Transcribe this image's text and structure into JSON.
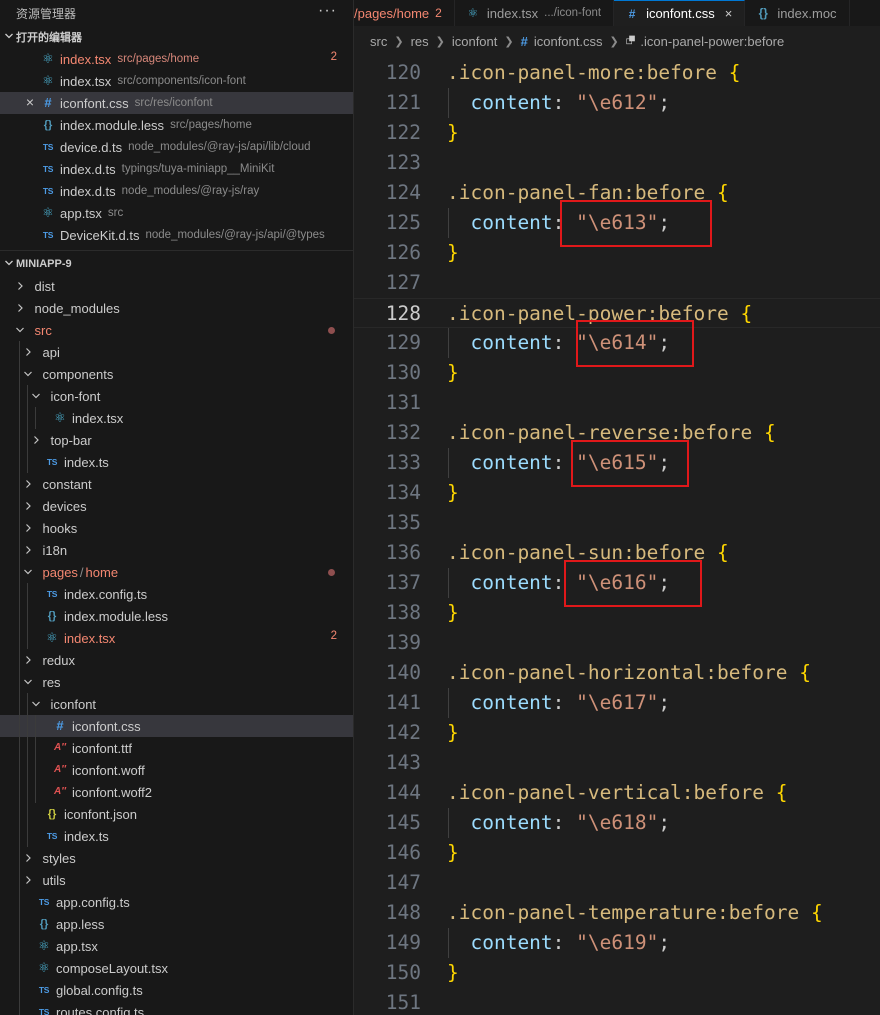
{
  "sidebar": {
    "title": "资源管理器",
    "more_label": "···",
    "open_editors": {
      "header": "打开的编辑器",
      "items": [
        {
          "icon": "react",
          "name": "index.tsx",
          "desc": "src/pages/home",
          "badge": "2",
          "modified": true,
          "active": false
        },
        {
          "icon": "react",
          "name": "index.tsx",
          "desc": "src/components/icon-font",
          "badge": "",
          "modified": false,
          "active": false
        },
        {
          "icon": "hash",
          "name": "iconfont.css",
          "desc": "src/res/iconfont",
          "badge": "",
          "modified": false,
          "active": true
        },
        {
          "icon": "braces",
          "name": "index.module.less",
          "desc": "src/pages/home",
          "badge": "",
          "modified": false,
          "active": false
        },
        {
          "icon": "ts",
          "name": "device.d.ts",
          "desc": "node_modules/@ray-js/api/lib/cloud",
          "badge": "",
          "modified": false,
          "active": false
        },
        {
          "icon": "ts",
          "name": "index.d.ts",
          "desc": "typings/tuya-miniapp__MiniKit",
          "badge": "",
          "modified": false,
          "active": false
        },
        {
          "icon": "ts",
          "name": "index.d.ts",
          "desc": "node_modules/@ray-js/ray",
          "badge": "",
          "modified": false,
          "active": false
        },
        {
          "icon": "react",
          "name": "app.tsx",
          "desc": "src",
          "badge": "",
          "modified": false,
          "active": false
        },
        {
          "icon": "ts",
          "name": "DeviceKit.d.ts",
          "desc": "node_modules/@ray-js/api/@types",
          "badge": "",
          "modified": false,
          "active": false
        }
      ],
      "close_label": "×"
    },
    "project": {
      "header": "MINIAPP-9",
      "tree": [
        {
          "depth": 0,
          "type": "folder",
          "open": false,
          "name": "dist"
        },
        {
          "depth": 0,
          "type": "folder",
          "open": false,
          "name": "node_modules"
        },
        {
          "depth": 0,
          "type": "folder",
          "open": true,
          "name": "src",
          "red": true,
          "dot": true
        },
        {
          "depth": 1,
          "type": "folder",
          "open": false,
          "name": "api"
        },
        {
          "depth": 1,
          "type": "folder",
          "open": true,
          "name": "components"
        },
        {
          "depth": 2,
          "type": "folder",
          "open": true,
          "name": "icon-font"
        },
        {
          "depth": 3,
          "type": "file",
          "icon": "react",
          "name": "index.tsx"
        },
        {
          "depth": 2,
          "type": "folder",
          "open": false,
          "name": "top-bar"
        },
        {
          "depth": 2,
          "type": "file",
          "icon": "ts",
          "name": "index.ts"
        },
        {
          "depth": 1,
          "type": "folder",
          "open": false,
          "name": "constant"
        },
        {
          "depth": 1,
          "type": "folder",
          "open": false,
          "name": "devices"
        },
        {
          "depth": 1,
          "type": "folder",
          "open": false,
          "name": "hooks"
        },
        {
          "depth": 1,
          "type": "folder",
          "open": false,
          "name": "i18n"
        },
        {
          "depth": 1,
          "type": "folder",
          "open": true,
          "name": "pages",
          "name2": "home",
          "red": true,
          "dot": true
        },
        {
          "depth": 2,
          "type": "file",
          "icon": "ts",
          "name": "index.config.ts"
        },
        {
          "depth": 2,
          "type": "file",
          "icon": "braces",
          "name": "index.module.less"
        },
        {
          "depth": 2,
          "type": "file",
          "icon": "react",
          "name": "index.tsx",
          "red": true,
          "badge": "2"
        },
        {
          "depth": 1,
          "type": "folder",
          "open": false,
          "name": "redux"
        },
        {
          "depth": 1,
          "type": "folder",
          "open": true,
          "name": "res"
        },
        {
          "depth": 2,
          "type": "folder",
          "open": true,
          "name": "iconfont"
        },
        {
          "depth": 3,
          "type": "file",
          "icon": "hash",
          "name": "iconfont.css",
          "selected": true
        },
        {
          "depth": 3,
          "type": "file",
          "icon": "font",
          "name": "iconfont.ttf"
        },
        {
          "depth": 3,
          "type": "file",
          "icon": "font",
          "name": "iconfont.woff"
        },
        {
          "depth": 3,
          "type": "file",
          "icon": "font",
          "name": "iconfont.woff2"
        },
        {
          "depth": 2,
          "type": "file",
          "icon": "json",
          "name": "iconfont.json"
        },
        {
          "depth": 2,
          "type": "file",
          "icon": "ts",
          "name": "index.ts"
        },
        {
          "depth": 1,
          "type": "folder",
          "open": false,
          "name": "styles"
        },
        {
          "depth": 1,
          "type": "folder",
          "open": false,
          "name": "utils"
        },
        {
          "depth": 1,
          "type": "file",
          "icon": "ts",
          "name": "app.config.ts"
        },
        {
          "depth": 1,
          "type": "file",
          "icon": "braces",
          "name": "app.less"
        },
        {
          "depth": 1,
          "type": "file",
          "icon": "react",
          "name": "app.tsx"
        },
        {
          "depth": 1,
          "type": "file",
          "icon": "react",
          "name": "composeLayout.tsx"
        },
        {
          "depth": 1,
          "type": "file",
          "icon": "ts",
          "name": "global.config.ts"
        },
        {
          "depth": 1,
          "type": "file",
          "icon": "ts",
          "name": "routes.config.ts"
        }
      ]
    }
  },
  "editor": {
    "tabs": [
      {
        "name": "/pages/home",
        "desc": "",
        "badge": "2",
        "icon": "",
        "modified": true,
        "active": false
      },
      {
        "name": "index.tsx",
        "desc": ".../icon-font",
        "badge": "",
        "icon": "react",
        "modified": false,
        "active": false
      },
      {
        "name": "iconfont.css",
        "desc": "",
        "badge": "",
        "icon": "hash",
        "modified": false,
        "active": true,
        "close": "×"
      },
      {
        "name": "index.moc",
        "desc": "",
        "badge": "",
        "icon": "braces",
        "modified": false,
        "active": false
      }
    ],
    "breadcrumb": [
      {
        "text": "src"
      },
      {
        "text": "res"
      },
      {
        "text": "iconfont"
      },
      {
        "text": "iconfont.css",
        "icon": "#"
      },
      {
        "text": ".icon-panel-power:before",
        "icon": "symbol"
      }
    ],
    "current_line": 128,
    "highlighted_lines": [
      125,
      129,
      133,
      137
    ],
    "lines": [
      {
        "n": 120,
        "kind": "open",
        "selector": ".icon-panel-more:before"
      },
      {
        "n": 121,
        "kind": "prop",
        "value": "\"\\e612\""
      },
      {
        "n": 122,
        "kind": "close"
      },
      {
        "n": 123,
        "kind": "blank"
      },
      {
        "n": 124,
        "kind": "open",
        "selector": ".icon-panel-fan:before"
      },
      {
        "n": 125,
        "kind": "prop",
        "value": "\"\\e613\""
      },
      {
        "n": 126,
        "kind": "close"
      },
      {
        "n": 127,
        "kind": "blank"
      },
      {
        "n": 128,
        "kind": "open",
        "selector": ".icon-panel-power:before"
      },
      {
        "n": 129,
        "kind": "prop",
        "value": "\"\\e614\""
      },
      {
        "n": 130,
        "kind": "close"
      },
      {
        "n": 131,
        "kind": "blank"
      },
      {
        "n": 132,
        "kind": "open",
        "selector": ".icon-panel-reverse:before"
      },
      {
        "n": 133,
        "kind": "prop",
        "value": "\"\\e615\""
      },
      {
        "n": 134,
        "kind": "close"
      },
      {
        "n": 135,
        "kind": "blank"
      },
      {
        "n": 136,
        "kind": "open",
        "selector": ".icon-panel-sun:before"
      },
      {
        "n": 137,
        "kind": "prop",
        "value": "\"\\e616\""
      },
      {
        "n": 138,
        "kind": "close"
      },
      {
        "n": 139,
        "kind": "blank"
      },
      {
        "n": 140,
        "kind": "open",
        "selector": ".icon-panel-horizontal:before"
      },
      {
        "n": 141,
        "kind": "prop",
        "value": "\"\\e617\""
      },
      {
        "n": 142,
        "kind": "close"
      },
      {
        "n": 143,
        "kind": "blank"
      },
      {
        "n": 144,
        "kind": "open",
        "selector": ".icon-panel-vertical:before"
      },
      {
        "n": 145,
        "kind": "prop",
        "value": "\"\\e618\""
      },
      {
        "n": 146,
        "kind": "close"
      },
      {
        "n": 147,
        "kind": "blank"
      },
      {
        "n": 148,
        "kind": "open",
        "selector": ".icon-panel-temperature:before"
      },
      {
        "n": 149,
        "kind": "prop",
        "value": "\"\\e619\""
      },
      {
        "n": 150,
        "kind": "close"
      },
      {
        "n": 151,
        "kind": "blank"
      }
    ],
    "tokens": {
      "property": "content",
      "colon": ":",
      "semicolon": ";",
      "open_brace": "{",
      "close_brace": "}"
    }
  },
  "colors": {
    "background": "#1e1e1e",
    "sidebar": "#181818",
    "selection": "#37373d",
    "modified": "#f48771",
    "selector": "#d7ba7d",
    "brace": "#ffd700",
    "property": "#9cdcfe",
    "string": "#ce9178",
    "highlight_box": "#e0181a",
    "active_tab_border": "#0078d4"
  }
}
